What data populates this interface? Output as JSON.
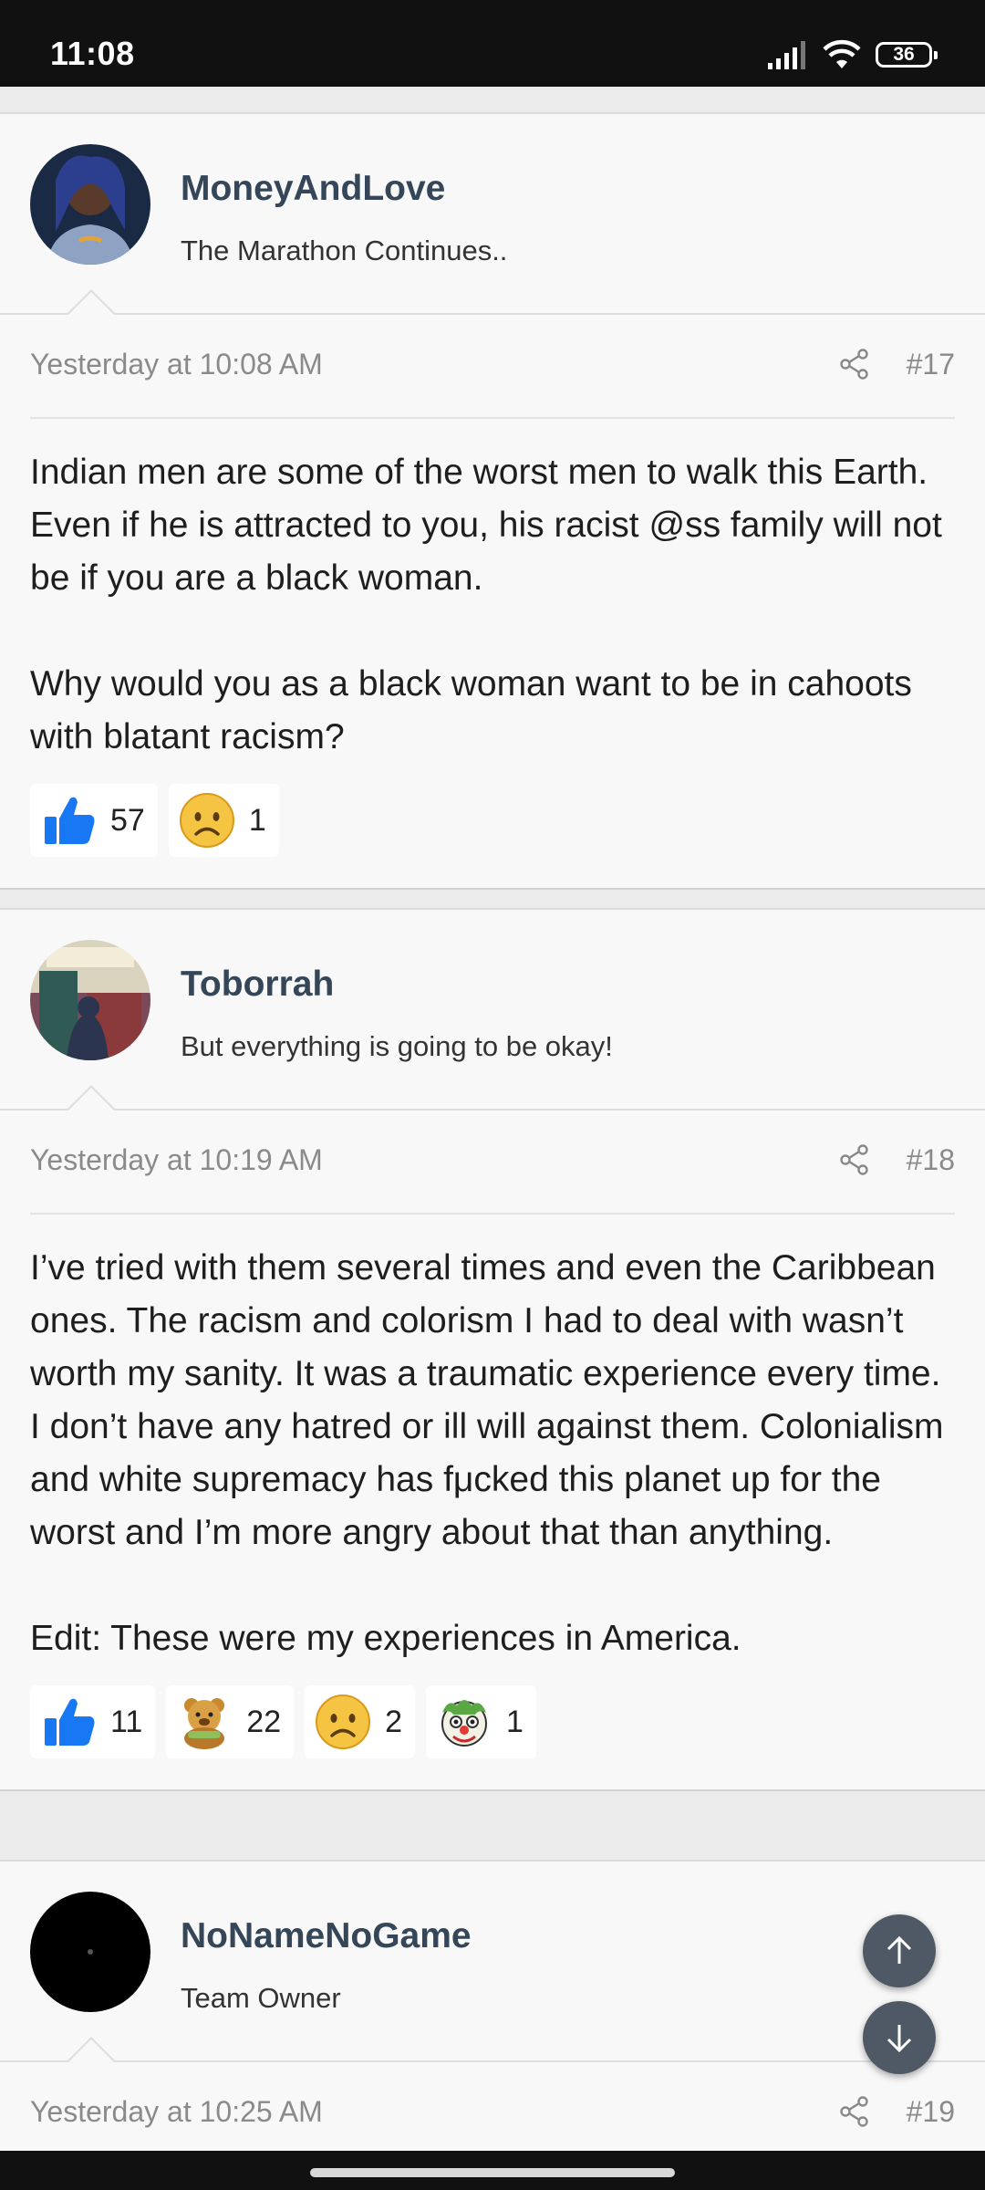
{
  "status": {
    "time": "11:08",
    "battery": "36"
  },
  "posts": [
    {
      "username": "MoneyAndLove",
      "user_title": "The Marathon Continues..",
      "date": "Yesterday at 10:08 AM",
      "number": "#17",
      "paragraphs": [
        "Indian men are some of the worst men to walk this Earth. Even if he is attracted to you, his racist @ss family will not be if you are a black woman.",
        "Why would you as a black woman want to be in cahoots with blatant racism?"
      ],
      "reactions": [
        {
          "icon": "thumbs-up-icon",
          "count": "57"
        },
        {
          "icon": "sad-face-icon",
          "count": "1"
        }
      ]
    },
    {
      "username": "Toborrah",
      "user_title": "But everything is going to be okay!",
      "date": "Yesterday at 10:19 AM",
      "number": "#18",
      "paragraphs": [
        "I’ve tried with them several times and even the Caribbean ones. The racism and colorism I had to deal with wasn’t worth my sanity. It was a traumatic experience every time. I don’t have any hatred or ill will against them. Colonialism and white supremacy has fμcked this planet up for the worst and I’m more angry about that than anything.",
        "Edit: These were my experiences in America."
      ],
      "reactions": [
        {
          "icon": "thumbs-up-icon",
          "count": "11"
        },
        {
          "icon": "bear-hug-icon",
          "count": "22"
        },
        {
          "icon": "sad-face-icon",
          "count": "2"
        },
        {
          "icon": "clown-face-icon",
          "count": "1"
        }
      ]
    },
    {
      "username": "NoNameNoGame",
      "user_title": "Team Owner",
      "date": "Yesterday at 10:25 AM",
      "number": "#19"
    }
  ],
  "colors": {
    "accent_username": "#344657",
    "fab": "#4e5965",
    "like_blue": "#1877f2"
  }
}
